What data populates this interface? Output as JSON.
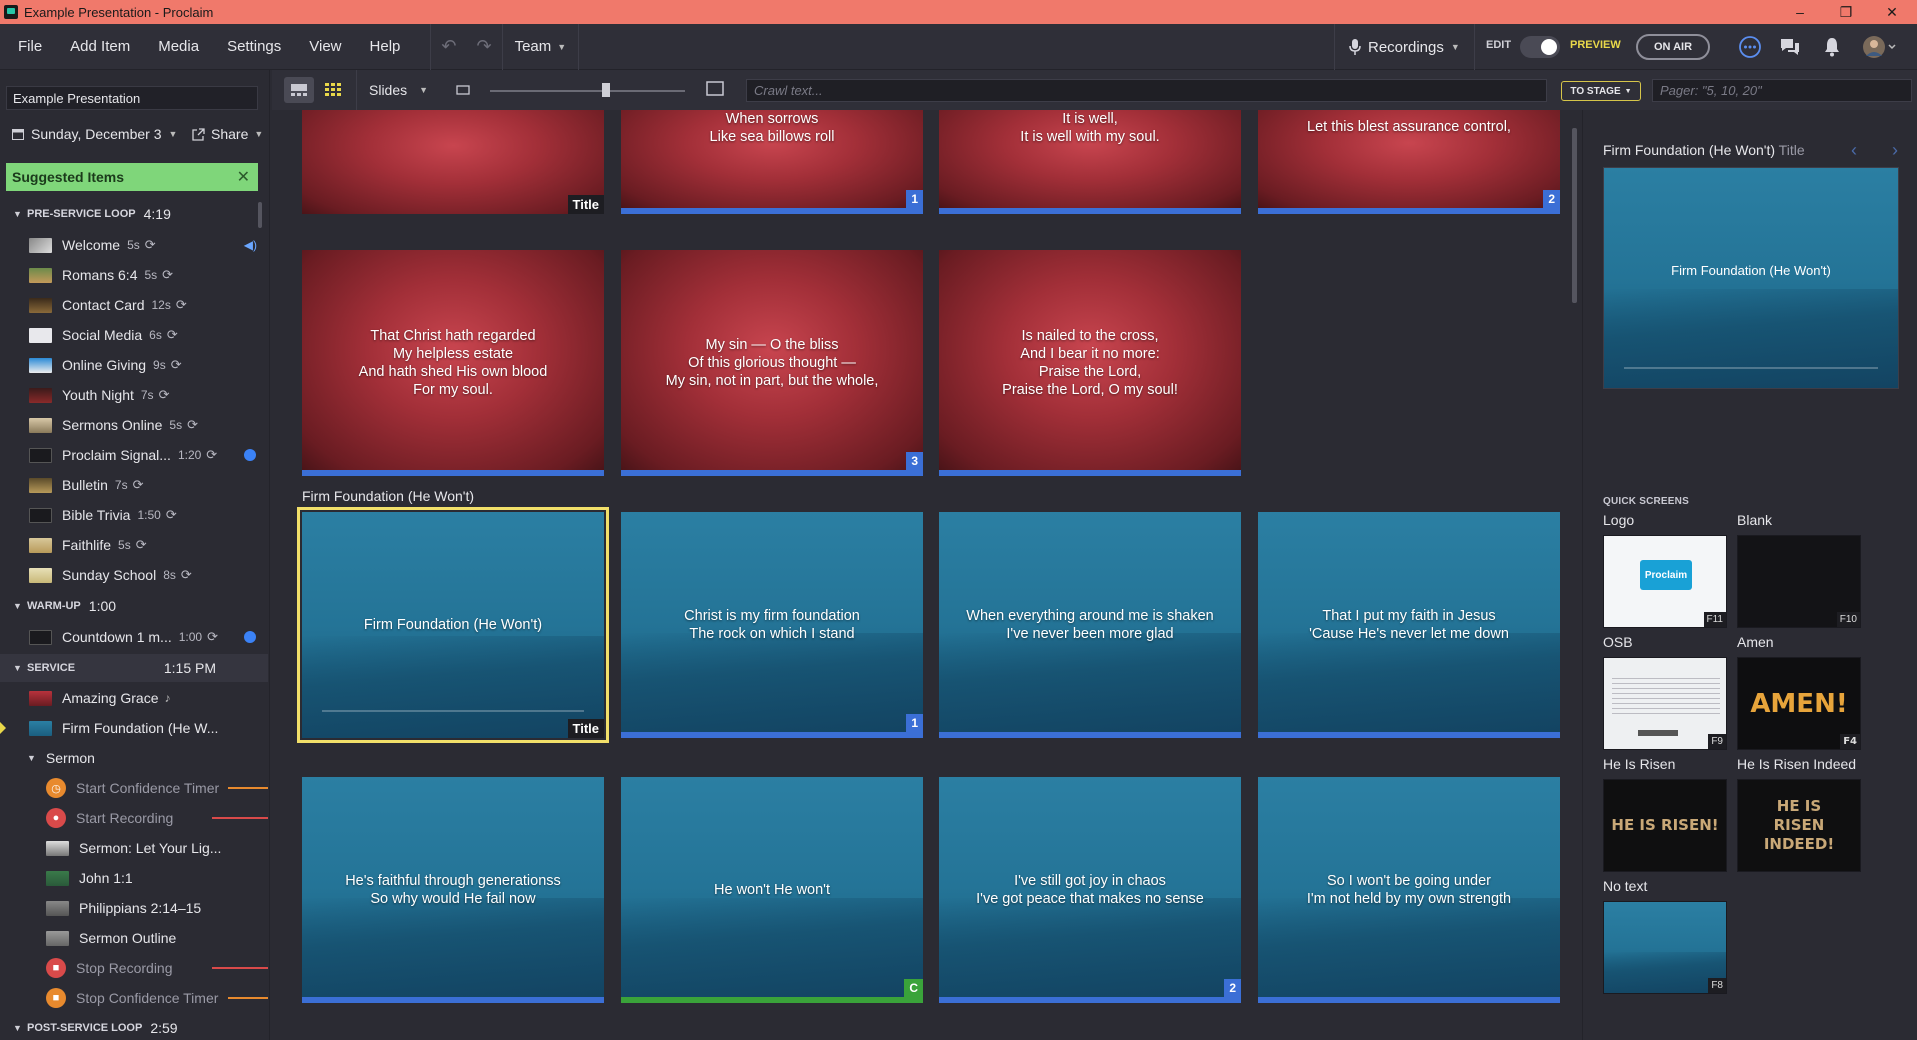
{
  "window": {
    "title": "Example Presentation - Proclaim",
    "min": "–",
    "max": "❐",
    "close": "✕"
  },
  "menu": {
    "items": [
      "File",
      "Add Item",
      "Media",
      "Settings",
      "View",
      "Help"
    ],
    "team": "Team",
    "recordings": "Recordings",
    "edit": "EDIT",
    "preview": "PREVIEW",
    "on_air": "ON AIR"
  },
  "toolbar": {
    "slides": "Slides",
    "crawl_placeholder": "Crawl text...",
    "to_stage": "TO STAGE",
    "pager_placeholder": "Pager: \"5, 10, 20\""
  },
  "sidebar": {
    "presentation": "Example Presentation",
    "date": "Sunday, December 3",
    "share": "Share",
    "suggested": "Suggested Items",
    "pre_service": {
      "label": "PRE-SERVICE LOOP",
      "duration": "4:19"
    },
    "pre_items": [
      {
        "label": "Welcome",
        "dur": "5s"
      },
      {
        "label": "Romans 6:4",
        "dur": "5s"
      },
      {
        "label": "Contact Card",
        "dur": "12s"
      },
      {
        "label": "Social Media",
        "dur": "6s"
      },
      {
        "label": "Online Giving",
        "dur": "9s"
      },
      {
        "label": "Youth Night",
        "dur": "7s"
      },
      {
        "label": "Sermons Online",
        "dur": "5s"
      },
      {
        "label": "Proclaim Signal...",
        "dur": "1:20"
      },
      {
        "label": "Bulletin",
        "dur": "7s"
      },
      {
        "label": "Bible Trivia",
        "dur": "1:50"
      },
      {
        "label": "Faithlife",
        "dur": "5s"
      },
      {
        "label": "Sunday School",
        "dur": "8s"
      }
    ],
    "warm_up": {
      "label": "WARM-UP",
      "duration": "1:00"
    },
    "warm_items": [
      {
        "label": "Countdown 1 m...",
        "dur": "1:00"
      }
    ],
    "service": {
      "label": "SERVICE",
      "duration": "1:15 PM"
    },
    "service_items": [
      {
        "label": "Amazing Grace"
      },
      {
        "label": "Firm Foundation (He W..."
      }
    ],
    "sermon": "Sermon",
    "sermon_items": [
      {
        "label": "Start Confidence Timer"
      },
      {
        "label": "Start Recording"
      },
      {
        "label": "Sermon: Let Your Lig..."
      },
      {
        "label": "John 1:1"
      },
      {
        "label": "Philippians 2:14–15"
      },
      {
        "label": "Sermon Outline"
      },
      {
        "label": "Stop Recording"
      },
      {
        "label": "Stop Confidence Timer"
      }
    ],
    "post_service": {
      "label": "POST-SERVICE LOOP",
      "duration": "2:59"
    }
  },
  "slides": {
    "row1": [
      {
        "text": "",
        "badge": "Title"
      },
      {
        "text": "When sorrows\nLike sea billows roll",
        "num": "1"
      },
      {
        "text": "It is well,\nIt is well with my soul.",
        "num": ""
      },
      {
        "text": "Let this blest assurance control,",
        "num": "2"
      }
    ],
    "row2": [
      {
        "text": "That Christ hath regarded\nMy helpless estate\nAnd hath shed His own blood\nFor my soul.",
        "num": ""
      },
      {
        "text": "My sin — O the bliss\nOf this glorious thought —\nMy sin, not in part, but the whole,",
        "num": "3"
      },
      {
        "text": "Is nailed to the cross,\nAnd I bear it no more:\nPraise the Lord,\nPraise the Lord, O my soul!",
        "num": ""
      }
    ],
    "group": "Firm Foundation (He Won't)",
    "row3": [
      {
        "text": "Firm Foundation (He Won't)",
        "badge": "Title"
      },
      {
        "text": "Christ is my firm foundation\nThe rock on which I stand",
        "num": "1"
      },
      {
        "text": "When everything around me is shaken\nI've never been more glad",
        "num": ""
      },
      {
        "text": "That I put my faith in Jesus\n'Cause He's never let me down",
        "num": ""
      }
    ],
    "row4": [
      {
        "text": "He's faithful through generationss\nSo why would He fail now",
        "num": ""
      },
      {
        "text": "He won't He won't",
        "num": "C"
      },
      {
        "text": "I've still got joy in chaos\nI've got peace that makes no sense",
        "num": "2"
      },
      {
        "text": "So I won't be going under\nI'm not held by my own strength",
        "num": ""
      }
    ]
  },
  "right_panel": {
    "title": "Firm Foundation (He Won't)",
    "title_sub": "Title",
    "preview_text": "Firm Foundation (He Won't)",
    "quick_screens": "QUICK SCREENS",
    "screens": [
      {
        "label": "Logo",
        "key": "F11",
        "logo": "Proclaim"
      },
      {
        "label": "Blank",
        "key": "F10"
      },
      {
        "label": "OSB",
        "key": "F9"
      },
      {
        "label": "Amen",
        "key": "F4",
        "art": "AMEN!"
      },
      {
        "label": "He Is Risen",
        "key": "",
        "art": "HE IS RISEN!"
      },
      {
        "label": "He Is Risen Indeed",
        "key": "",
        "art": "HE IS RISEN INDEED!"
      },
      {
        "label": "No text",
        "key": "F8"
      }
    ]
  }
}
